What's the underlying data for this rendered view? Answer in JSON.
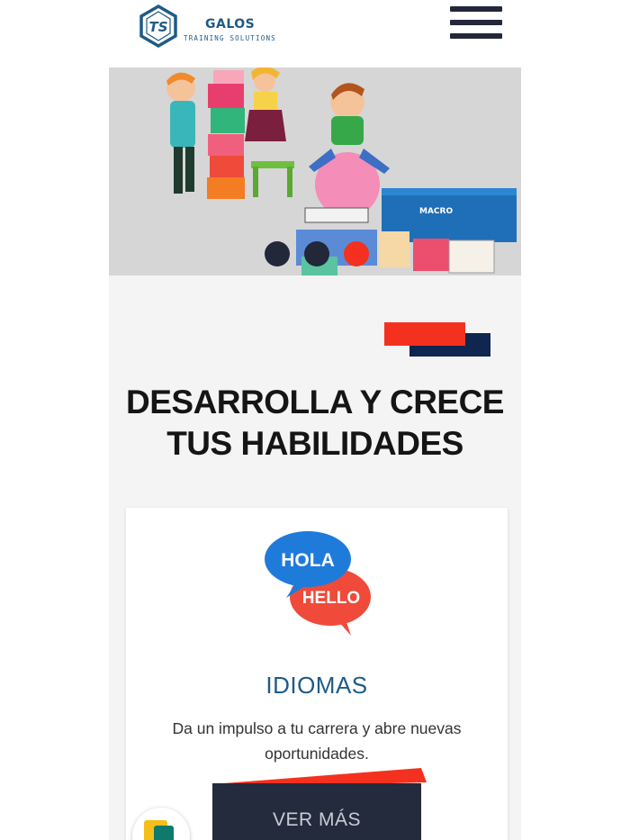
{
  "header": {
    "brand_name": "GALOS",
    "brand_tagline": "TRAINING SOLUTIONS",
    "logo_monogram": "TS",
    "menu_icon": "hamburger-menu-icon"
  },
  "hero": {
    "slides_count": 3,
    "active_slide": 3,
    "product_box_label": "MACRO"
  },
  "section": {
    "headline_line1": "DESARROLLA Y CRECE",
    "headline_line2": "TUS HABILIDADES"
  },
  "card": {
    "bubble_top": "HOLA",
    "bubble_bottom": "HELLO",
    "title": "IDIOMAS",
    "description": "Da un impulso a tu carrera y abre nuevas oportunidades.",
    "button_label": "VER MÁS"
  },
  "colors": {
    "accent_red": "#f3311e",
    "navy": "#0f2650",
    "title_blue": "#1f5a86",
    "button_dark": "#232b3d",
    "bubble_blue": "#1f7bd9",
    "bubble_red": "#ef4a3a"
  }
}
